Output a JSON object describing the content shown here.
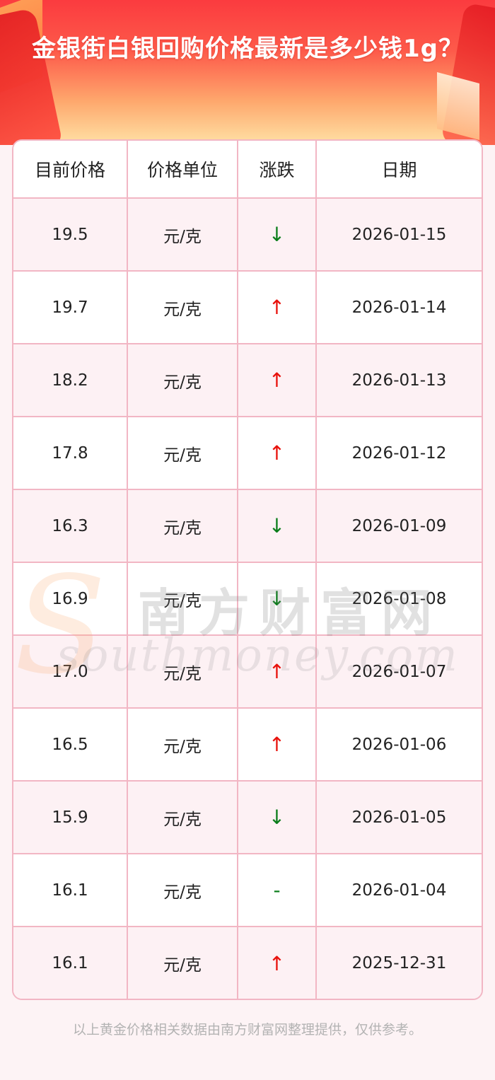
{
  "header": {
    "title": "金银街白银回购价格最新是多少钱1g？"
  },
  "table": {
    "columns": [
      "目前价格",
      "价格单位",
      "涨跌",
      "日期"
    ],
    "rows": [
      {
        "price": "19.5",
        "unit": "元/克",
        "trend": "↓",
        "trend_type": "down",
        "date": "2026-01-15"
      },
      {
        "price": "19.7",
        "unit": "元/克",
        "trend": "↑",
        "trend_type": "up",
        "date": "2026-01-14"
      },
      {
        "price": "18.2",
        "unit": "元/克",
        "trend": "↑",
        "trend_type": "up",
        "date": "2026-01-13"
      },
      {
        "price": "17.8",
        "unit": "元/克",
        "trend": "↑",
        "trend_type": "up",
        "date": "2026-01-12"
      },
      {
        "price": "16.3",
        "unit": "元/克",
        "trend": "↓",
        "trend_type": "down",
        "date": "2026-01-09"
      },
      {
        "price": "16.9",
        "unit": "元/克",
        "trend": "↓",
        "trend_type": "down",
        "date": "2026-01-08"
      },
      {
        "price": "17.0",
        "unit": "元/克",
        "trend": "↑",
        "trend_type": "up",
        "date": "2026-01-07"
      },
      {
        "price": "16.5",
        "unit": "元/克",
        "trend": "↑",
        "trend_type": "up",
        "date": "2026-01-06"
      },
      {
        "price": "15.9",
        "unit": "元/克",
        "trend": "↓",
        "trend_type": "down",
        "date": "2026-01-05"
      },
      {
        "price": "16.1",
        "unit": "元/克",
        "trend": "-",
        "trend_type": "flat",
        "date": "2026-01-04"
      },
      {
        "price": "16.1",
        "unit": "元/克",
        "trend": "↑",
        "trend_type": "up",
        "date": "2025-12-31"
      }
    ]
  },
  "watermark": {
    "cn": "南方财富网",
    "en": "southmoney.com",
    "initial": "S"
  },
  "footer": {
    "note": "以上黄金价格相关数据由南方财富网整理提供，仅供参考。"
  },
  "colors": {
    "up": "#e8120c",
    "down": "#0a7d1a",
    "border": "#f2b6c4",
    "banner_top": "#fb3b3f"
  }
}
